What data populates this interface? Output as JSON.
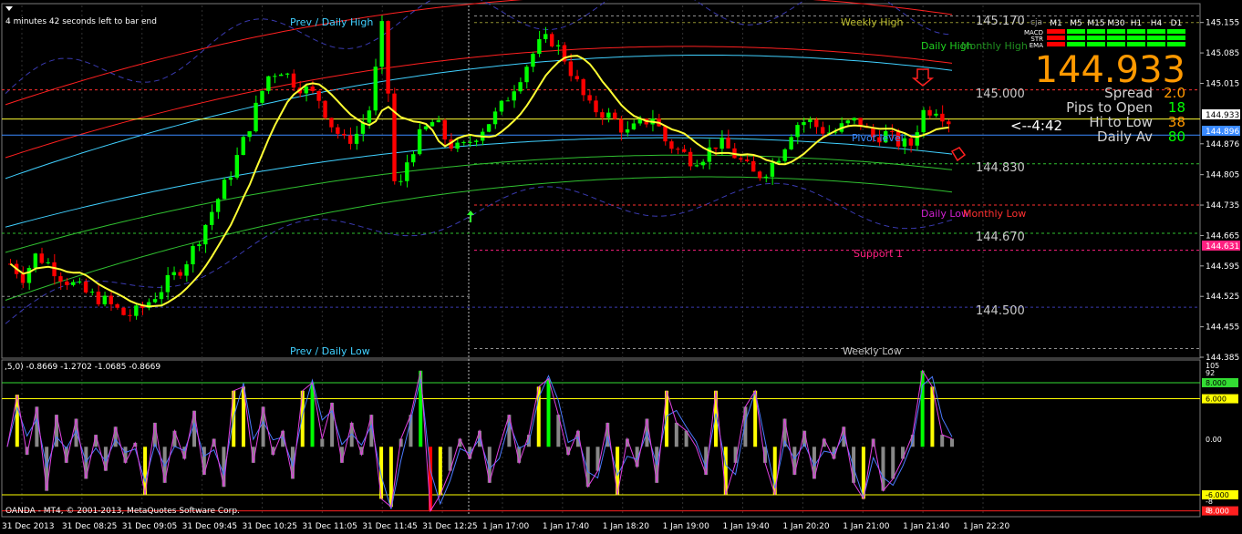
{
  "window": {
    "timer_text": "4 minutes 42 seconds left to bar end",
    "copyright": "OANDA - MT4, © 2001-2013, MetaQuotes Software Corp."
  },
  "colors": {
    "background": "#000000",
    "bull": "#00ff00",
    "bear": "#ff0000",
    "grid": "#303030",
    "ma_yellow": "#ffff33",
    "band_red": "#ff2020",
    "band_cyan": "#40d0ff",
    "band_green": "#30c030",
    "envelope_blue": "#3a3ab0",
    "orange": "#ff9900",
    "pivot_blue": "#3a8aff"
  },
  "price_axis": {
    "ticks": [
      "145.155",
      "145.085",
      "145.015",
      "144.933",
      "144.876",
      "144.805",
      "144.735",
      "144.665",
      "144.595",
      "144.525",
      "144.455",
      "144.385"
    ],
    "current_price_label": "144.933",
    "pivot_label": "144.896",
    "support_label": "144.631"
  },
  "level_labels": {
    "prev_daily_high": "Prev / Daily High",
    "prev_daily_low": "Prev / Daily Low",
    "weekly_high": "Weekly High",
    "weekly_low": "Weekly Low",
    "daily_high": "Daily High",
    "monthly_high": "Monthly High",
    "daily_low": "Daily Low",
    "monthly_low": "Monthly Low",
    "pivot_level": "Pivot level",
    "support_1": "Support 1",
    "round_145170": "145.170",
    "round_145000": "145.000",
    "round_144830": "144.830",
    "round_144670": "144.670",
    "round_144500": "144.500",
    "timer_arrow": "<--4:42"
  },
  "info_panel": {
    "big_price": "144.933",
    "rows": [
      {
        "label": "Spread",
        "value": "2.0",
        "color": "#ff9900"
      },
      {
        "label": "Pips to Open",
        "value": "18",
        "color": "#00ff00"
      },
      {
        "label": "Hi to Low",
        "value": "38",
        "color": "#ff9900"
      },
      {
        "label": "Daily Av",
        "value": "80",
        "color": "#00ff00"
      }
    ]
  },
  "mtf_panel": {
    "corner_label": "cja",
    "timeframes": [
      "M1",
      "M5",
      "M15",
      "M30",
      "H1",
      "H4",
      "D1"
    ],
    "rows": [
      {
        "name": "MACD",
        "states": [
          "down",
          "up",
          "up",
          "up",
          "up",
          "up",
          "up"
        ]
      },
      {
        "name": "STR",
        "states": [
          "down",
          "up",
          "up",
          "up",
          "up",
          "up",
          "up"
        ]
      },
      {
        "name": "EMA",
        "states": [
          "down",
          "up",
          "up",
          "up",
          "up",
          "up",
          "up"
        ]
      }
    ]
  },
  "time_axis": {
    "labels": [
      "31 Dec 2013",
      "31 Dec 08:25",
      "31 Dec 09:05",
      "31 Dec 09:45",
      "31 Dec 10:25",
      "31 Dec 11:05",
      "31 Dec 11:45",
      "31 Dec 12:25",
      "1 Jan 17:00",
      "1 Jan 17:40",
      "1 Jan 18:20",
      "1 Jan 19:00",
      "1 Jan 19:40",
      "1 Jan 20:20",
      "1 Jan 21:00",
      "1 Jan 21:40",
      "1 Jan 22:20"
    ]
  },
  "oscillator": {
    "header": ",5,0) -0.8669 -1.2702 -1.0685 -0.8669",
    "axis_ticks": [
      "105",
      "92",
      "0.00",
      "-8",
      "8"
    ],
    "levels": [
      {
        "label": "8.000",
        "value": 8,
        "color": "#33dd33"
      },
      {
        "label": "6.000",
        "value": 6,
        "color": "#ffff00"
      },
      {
        "label": "-6.000",
        "value": -6,
        "color": "#ffff00"
      },
      {
        "label": "-8.000",
        "value": -8,
        "color": "#ff2020"
      }
    ]
  },
  "chart_data": [
    {
      "type": "candlestick",
      "title": "",
      "ylim": [
        144.385,
        145.19
      ],
      "x": [
        "31 Dec 2013",
        "31 Dec 08:25",
        "31 Dec 09:05",
        "31 Dec 09:45",
        "31 Dec 10:25",
        "31 Dec 11:05",
        "31 Dec 11:45",
        "31 Dec 12:25",
        "1 Jan 17:00",
        "1 Jan 17:40",
        "1 Jan 18:20",
        "1 Jan 19:00",
        "1 Jan 19:40",
        "1 Jan 20:20",
        "1 Jan 21:00",
        "1 Jan 21:40",
        "1 Jan 22:20"
      ],
      "close_path": [
        144.6,
        144.57,
        144.62,
        144.6,
        144.57,
        144.55,
        144.53,
        144.52,
        144.5,
        144.48,
        144.49,
        144.52,
        144.55,
        144.58,
        144.62,
        144.68,
        144.74,
        144.8,
        144.87,
        144.95,
        145.03,
        145.05,
        145.02,
        145.0,
        144.98,
        144.92,
        144.88,
        144.9,
        144.96,
        145.16,
        144.74,
        144.85,
        144.9,
        144.93,
        144.88,
        144.86,
        144.89,
        144.92,
        144.95,
        145.0,
        145.05,
        145.1,
        145.12,
        145.08,
        145.02,
        144.96,
        144.95,
        144.93,
        144.9,
        144.92,
        144.94,
        144.88,
        144.86,
        144.84,
        144.85,
        144.88,
        144.86,
        144.83,
        144.8,
        144.82,
        144.86,
        144.92,
        144.93,
        144.91,
        144.9,
        144.92,
        144.93,
        144.89,
        144.9,
        144.88,
        144.87,
        144.95,
        144.96,
        144.93
      ]
    },
    {
      "type": "line",
      "title": "",
      "ylim": [
        -8.5,
        10.5
      ],
      "values": [
        0.0,
        6.5,
        -1.0,
        5.0,
        -5.5,
        4.0,
        -2.0,
        3.5,
        -4.0,
        1.5,
        -3.0,
        2.5,
        -2.0,
        0.5,
        -6.0,
        3.0,
        -4.5,
        2.0,
        -1.5,
        4.5,
        -3.5,
        1.0,
        -5.0,
        7.0,
        7.5,
        -2.0,
        5.0,
        -1.0,
        2.0,
        -4.0,
        7.0,
        8.0,
        1.0,
        5.5,
        -2.0,
        3.0,
        -1.0,
        4.0,
        -6.5,
        -7.5,
        1.0,
        4.0,
        9.5,
        -8.0,
        -6.0,
        -3.0,
        1.0,
        -1.5,
        2.0,
        -4.5,
        0.0,
        4.0,
        -2.0,
        1.5,
        7.5,
        8.5,
        4.0,
        -1.0,
        2.0,
        -5.0,
        -3.0,
        3.0,
        -6.0,
        1.0,
        -2.5,
        3.5,
        -4.5,
        7.0,
        3.0,
        2.0,
        0.0,
        -3.5,
        7.0,
        -6.0,
        -2.0,
        5.0,
        7.0,
        -2.0,
        -6.0,
        3.5,
        -3.5,
        2.0,
        -4.0,
        1.0,
        -1.5,
        2.5,
        -4.5,
        -6.5,
        1.0,
        -5.5,
        -4.0,
        -1.5,
        1.5,
        9.5,
        7.5,
        1.5,
        1.0
      ]
    }
  ]
}
